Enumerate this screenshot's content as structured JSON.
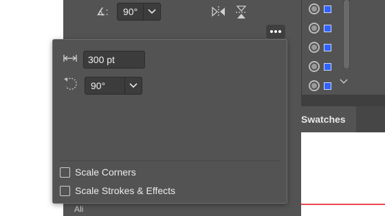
{
  "properties": {
    "rotate_angle": "90°",
    "bottom_label": "Ali"
  },
  "scale_popup": {
    "width_value": "300 pt",
    "rotate_value": "90°",
    "checkboxes": [
      {
        "label": "Scale Corners",
        "checked": false
      },
      {
        "label": "Scale Strokes & Effects",
        "checked": false
      }
    ]
  },
  "panels": {
    "swatches_tab": "Swatches"
  },
  "colors": {
    "panel_bg": "#535353",
    "field_bg": "#3c3c3c",
    "layer_square": "#2f62ff",
    "red_guide": "#e8474f"
  }
}
